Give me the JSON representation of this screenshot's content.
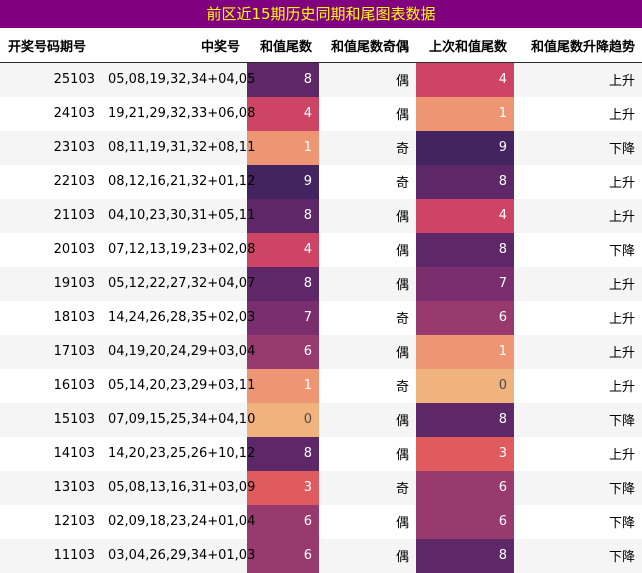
{
  "title": "前区近15期历史同期和尾图表数据",
  "columns": [
    "开奖号码期号",
    "中奖号",
    "和值尾数",
    "和值尾数奇偶",
    "上次和值尾数",
    "和值尾数升降趋势"
  ],
  "tail_colors": {
    "0": "#f0b37e",
    "1": "#ee9673",
    "3": "#e05b5e",
    "4": "#cd4465",
    "6": "#983a6e",
    "7": "#7b2e6e",
    "8": "#5e2768",
    "9": "#432460"
  },
  "rows": [
    {
      "issue": "25103",
      "numbers": "05,08,19,32,34+04,05",
      "tail": "8",
      "parity": "偶",
      "prev_tail": "4",
      "trend": "上升"
    },
    {
      "issue": "24103",
      "numbers": "19,21,29,32,33+06,08",
      "tail": "4",
      "parity": "偶",
      "prev_tail": "1",
      "trend": "上升"
    },
    {
      "issue": "23103",
      "numbers": "08,11,19,31,32+08,11",
      "tail": "1",
      "parity": "奇",
      "prev_tail": "9",
      "trend": "下降"
    },
    {
      "issue": "22103",
      "numbers": "08,12,16,21,32+01,12",
      "tail": "9",
      "parity": "奇",
      "prev_tail": "8",
      "trend": "上升"
    },
    {
      "issue": "21103",
      "numbers": "04,10,23,30,31+05,11",
      "tail": "8",
      "parity": "偶",
      "prev_tail": "4",
      "trend": "上升"
    },
    {
      "issue": "20103",
      "numbers": "07,12,13,19,23+02,08",
      "tail": "4",
      "parity": "偶",
      "prev_tail": "8",
      "trend": "下降"
    },
    {
      "issue": "19103",
      "numbers": "05,12,22,27,32+04,07",
      "tail": "8",
      "parity": "偶",
      "prev_tail": "7",
      "trend": "上升"
    },
    {
      "issue": "18103",
      "numbers": "14,24,26,28,35+02,03",
      "tail": "7",
      "parity": "奇",
      "prev_tail": "6",
      "trend": "上升"
    },
    {
      "issue": "17103",
      "numbers": "04,19,20,24,29+03,04",
      "tail": "6",
      "parity": "偶",
      "prev_tail": "1",
      "trend": "上升"
    },
    {
      "issue": "16103",
      "numbers": "05,14,20,23,29+03,11",
      "tail": "1",
      "parity": "奇",
      "prev_tail": "0",
      "trend": "上升"
    },
    {
      "issue": "15103",
      "numbers": "07,09,15,25,34+04,10",
      "tail": "0",
      "parity": "偶",
      "prev_tail": "8",
      "trend": "下降"
    },
    {
      "issue": "14103",
      "numbers": "14,20,23,25,26+10,12",
      "tail": "8",
      "parity": "偶",
      "prev_tail": "3",
      "trend": "上升"
    },
    {
      "issue": "13103",
      "numbers": "05,08,13,16,31+03,09",
      "tail": "3",
      "parity": "奇",
      "prev_tail": "6",
      "trend": "下降"
    },
    {
      "issue": "12103",
      "numbers": "02,09,18,23,24+01,04",
      "tail": "6",
      "parity": "偶",
      "prev_tail": "6",
      "trend": "下降"
    },
    {
      "issue": "11103",
      "numbers": "03,04,26,29,34+01,03",
      "tail": "6",
      "parity": "偶",
      "prev_tail": "8",
      "trend": "下降"
    }
  ]
}
